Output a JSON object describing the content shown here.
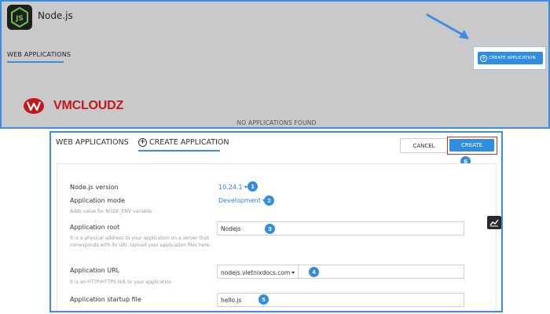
{
  "top": {
    "app_title": "Node.js",
    "tab_label": "WEB APPLICATIONS",
    "brand": "VMCLOUDZ",
    "empty_message": "NO APPLICATIONS FOUND",
    "create_button_label": "CREATE APPLICATION"
  },
  "panel": {
    "tab_web": "WEB APPLICATIONS",
    "tab_create": "CREATE APPLICATION",
    "cancel_label": "CANCEL",
    "create_label": "CREATE"
  },
  "form": {
    "version": {
      "label": "Node.js version",
      "value": "10.24.1",
      "badge": "1"
    },
    "mode": {
      "label": "Application mode",
      "hint": "Adds value for NODE_ENV variable",
      "value": "Development",
      "badge": "2"
    },
    "root": {
      "label": "Application root",
      "hint": "It is a physical address to your application on a server that corresponds with its URI. Upload your application files here.",
      "value": "Nodejs",
      "badge": "3"
    },
    "url": {
      "label": "Application URL",
      "hint": "It is an HTTP/HTTPS link to your application",
      "domain": "nodejs.vietnixdocs.com",
      "path": "",
      "badge": "4"
    },
    "startup": {
      "label": "Application startup file",
      "value": "hello.js",
      "badge": "5"
    }
  },
  "create_badge": "6",
  "colors": {
    "accent": "#2f8ee0",
    "highlight_border": "#d42a2a",
    "brand": "#c4161c",
    "backdrop": "#c9c9c9"
  },
  "icons": [
    "nodejs-logo-icon",
    "vmcloudz-logo-icon",
    "plus-circle-icon",
    "chevron-down-icon",
    "chart-icon",
    "arrow-pointer"
  ]
}
